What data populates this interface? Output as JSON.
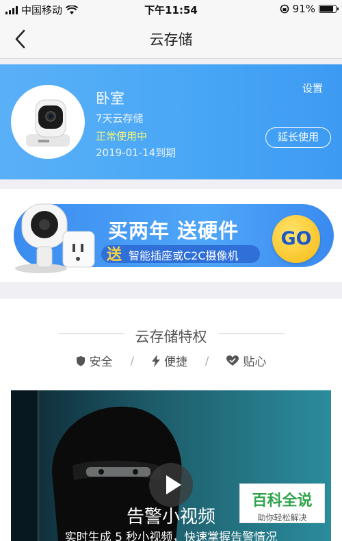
{
  "status_bar": {
    "carrier": "中国移动",
    "time": "下午11:54",
    "battery": "91%",
    "battery_level": 0.91
  },
  "nav": {
    "title": "云存储",
    "back_icon": "chevron-left-icon"
  },
  "device": {
    "name": "卧室",
    "plan": "7天云存储",
    "status": "正常使用中",
    "expire": "2019-01-14到期",
    "settings_label": "设置",
    "extend_label": "延长使用"
  },
  "promo": {
    "headline": "买两年 送硬件",
    "sub_emphasis": "送",
    "sub_text": "智能插座或C2C摄像机",
    "go_label": "GO"
  },
  "features": {
    "title": "云存储特权",
    "items": [
      {
        "label": "安全",
        "icon": "shield-icon"
      },
      {
        "label": "便捷",
        "icon": "lightning-icon"
      },
      {
        "label": "贴心",
        "icon": "heart-icon"
      }
    ],
    "separator": "/"
  },
  "video": {
    "title": "告警小视频",
    "desc": "实时生成 5 秒小视频，快速掌握告警情况"
  },
  "watermark": {
    "brand": "百科全说",
    "slogan": "助你轻松解决"
  },
  "colors": {
    "card_blue": "#49a7f6",
    "status_yellow": "#f3f57a",
    "go_yellow": "#f8b90f"
  }
}
